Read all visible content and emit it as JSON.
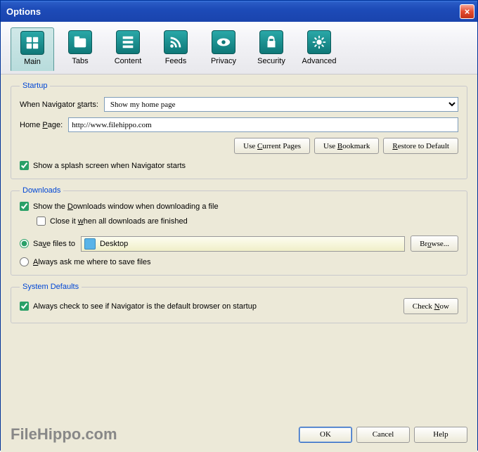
{
  "title": "Options",
  "tabs": [
    "Main",
    "Tabs",
    "Content",
    "Feeds",
    "Privacy",
    "Security",
    "Advanced"
  ],
  "startup": {
    "legend": "Startup",
    "when_label": "When Navigator starts:",
    "when_value": "Show my home page",
    "home_label": "Home Page:",
    "home_value": "http://www.filehippo.com",
    "use_current": "Use Current Pages",
    "use_bookmark": "Use Bookmark",
    "restore": "Restore to Default",
    "splash": "Show a splash screen when Navigator starts"
  },
  "downloads": {
    "legend": "Downloads",
    "show_window": "Show the Downloads window when downloading a file",
    "close_finished": "Close it when all downloads are finished",
    "save_to": "Save files to",
    "desktop": "Desktop",
    "browse": "Browse...",
    "always_ask": "Always ask me where to save files"
  },
  "defaults": {
    "legend": "System Defaults",
    "always_check": "Always check to see if Navigator is the default browser on startup",
    "check_now": "Check Now"
  },
  "buttons": {
    "ok": "OK",
    "cancel": "Cancel",
    "help": "Help"
  },
  "watermark": "FileHippo.com"
}
